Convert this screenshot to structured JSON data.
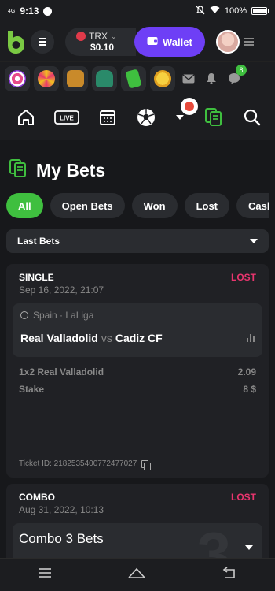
{
  "status": {
    "network": "4G",
    "time": "9:13",
    "battery": "100%"
  },
  "header": {
    "currency": "TRX",
    "balance": "$0.10",
    "wallet_label": "Wallet"
  },
  "games": {
    "chat_badge": "8"
  },
  "page": {
    "title": "My Bets"
  },
  "filters": [
    "All",
    "Open Bets",
    "Won",
    "Lost",
    "Cashe"
  ],
  "dropdown": {
    "label": "Last Bets"
  },
  "bets": [
    {
      "type": "SINGLE",
      "date": "Sep 16, 2022, 21:07",
      "status": "LOST",
      "league": "Spain · LaLiga",
      "home": "Real Valladolid",
      "vs": "vs",
      "away": "Cadiz CF",
      "selection": "1x2 Real Valladolid",
      "odds": "2.09",
      "stake_label": "Stake",
      "stake": "8 $",
      "ticket": "Ticket ID: 2182535400772477027"
    },
    {
      "type": "COMBO",
      "date": "Aug 31, 2022, 10:13",
      "status": "LOST",
      "title": "Combo 3 Bets",
      "count": "3"
    }
  ]
}
